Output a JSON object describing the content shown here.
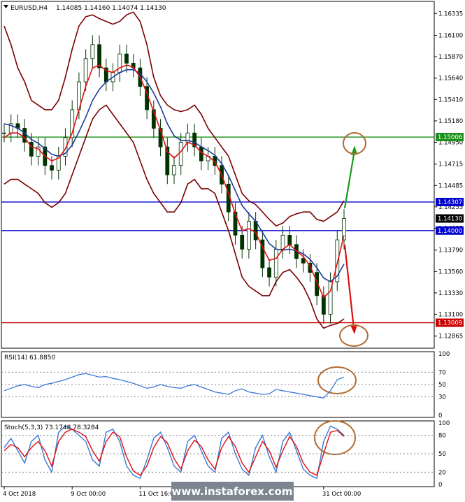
{
  "header": {
    "symbol": "EURUSD,H4",
    "ohlc": "1.14085 1.14160 1.14074 1.14130"
  },
  "watermark": "www.instaforex.com",
  "chart_data": [
    {
      "type": "candlestick",
      "name": "main",
      "ylim": [
        1.1275,
        1.1645
      ],
      "price_ticks": [
        "1.16335",
        "1.16100",
        "1.15870",
        "1.15640",
        "1.15410",
        "1.15180",
        "1.14950",
        "1.14715",
        "1.14485",
        "1.14255",
        "1.14025",
        "1.13790",
        "1.13560",
        "1.13330",
        "1.13100",
        "1.12865"
      ],
      "price_tick_values": [
        1.16335,
        1.161,
        1.1587,
        1.1564,
        1.1541,
        1.1518,
        1.1495,
        1.14715,
        1.14485,
        1.14255,
        1.14025,
        1.1379,
        1.1356,
        1.1333,
        1.131,
        1.12865
      ],
      "levels": [
        {
          "label": "1.15006",
          "value": 1.15006,
          "color": "#1a8f1a"
        },
        {
          "label": "1.14307",
          "value": 1.14307,
          "color": "#0000cc"
        },
        {
          "label": "1.14000",
          "value": 1.14,
          "color": "#0000cc"
        },
        {
          "label": "1.13009",
          "value": 1.13009,
          "color": "#cc0000"
        }
      ],
      "current_price": {
        "label": "1.14130",
        "value": 1.1413
      },
      "close": [
        1.1505,
        1.1515,
        1.151,
        1.1495,
        1.148,
        1.149,
        1.147,
        1.1465,
        1.148,
        1.15,
        1.153,
        1.156,
        1.1585,
        1.16,
        1.1575,
        1.156,
        1.157,
        1.159,
        1.158,
        1.1575,
        1.1555,
        1.153,
        1.151,
        1.149,
        1.146,
        1.147,
        1.1495,
        1.1505,
        1.149,
        1.1475,
        1.148,
        1.147,
        1.145,
        1.142,
        1.1395,
        1.138,
        1.141,
        1.139,
        1.136,
        1.135,
        1.138,
        1.1395,
        1.1385,
        1.137,
        1.1365,
        1.1355,
        1.133,
        1.131,
        1.1345,
        1.139,
        1.1413
      ],
      "ma_fast": [
        1.15,
        1.1505,
        1.1505,
        1.15,
        1.149,
        1.1488,
        1.148,
        1.1475,
        1.1478,
        1.1488,
        1.1505,
        1.153,
        1.1555,
        1.1575,
        1.1578,
        1.1572,
        1.157,
        1.1575,
        1.1578,
        1.1576,
        1.1565,
        1.1548,
        1.1528,
        1.1508,
        1.1485,
        1.1478,
        1.1485,
        1.1495,
        1.1492,
        1.1484,
        1.148,
        1.1474,
        1.146,
        1.144,
        1.1418,
        1.14,
        1.1402,
        1.1398,
        1.1382,
        1.1368,
        1.137,
        1.138,
        1.1385,
        1.1378,
        1.1372,
        1.1362,
        1.1345,
        1.1328,
        1.1335,
        1.1365,
        1.1395
      ],
      "ma_slow": [
        1.1515,
        1.1513,
        1.151,
        1.1505,
        1.1498,
        1.1494,
        1.1488,
        1.1482,
        1.148,
        1.1483,
        1.1492,
        1.1506,
        1.1522,
        1.154,
        1.1552,
        1.156,
        1.1565,
        1.157,
        1.1573,
        1.1573,
        1.1569,
        1.156,
        1.1548,
        1.1533,
        1.1515,
        1.1502,
        1.1497,
        1.1497,
        1.1495,
        1.149,
        1.1486,
        1.1481,
        1.1472,
        1.1459,
        1.1443,
        1.1427,
        1.1418,
        1.141,
        1.1398,
        1.1386,
        1.138,
        1.1379,
        1.138,
        1.1378,
        1.1375,
        1.1369,
        1.136,
        1.1349,
        1.1345,
        1.1351,
        1.1364
      ],
      "bb_upper": [
        1.162,
        1.16,
        1.1575,
        1.156,
        1.154,
        1.1535,
        1.153,
        1.153,
        1.154,
        1.1565,
        1.1595,
        1.162,
        1.163,
        1.1632,
        1.1628,
        1.1625,
        1.1622,
        1.1625,
        1.1632,
        1.1635,
        1.1625,
        1.16,
        1.1565,
        1.1545,
        1.1535,
        1.153,
        1.1528,
        1.153,
        1.1535,
        1.1525,
        1.151,
        1.15,
        1.149,
        1.148,
        1.146,
        1.144,
        1.1432,
        1.1428,
        1.142,
        1.1412,
        1.1405,
        1.1408,
        1.1415,
        1.1418,
        1.142,
        1.142,
        1.1412,
        1.141,
        1.1415,
        1.142,
        1.1432
      ],
      "bb_lower": [
        1.145,
        1.1455,
        1.1455,
        1.145,
        1.1445,
        1.144,
        1.143,
        1.1425,
        1.143,
        1.144,
        1.146,
        1.148,
        1.15,
        1.152,
        1.153,
        1.1535,
        1.1525,
        1.1515,
        1.1505,
        1.1495,
        1.1475,
        1.1455,
        1.144,
        1.143,
        1.142,
        1.142,
        1.143,
        1.145,
        1.1455,
        1.1445,
        1.1445,
        1.144,
        1.142,
        1.14,
        1.1375,
        1.135,
        1.134,
        1.1335,
        1.133,
        1.133,
        1.1345,
        1.1355,
        1.1358,
        1.135,
        1.134,
        1.1325,
        1.1305,
        1.1295,
        1.1298,
        1.13,
        1.1305
      ]
    },
    {
      "type": "line",
      "name": "rsi",
      "label": "RSI(14) 61.8850",
      "ylim": [
        0,
        100
      ],
      "ticks": [
        "100",
        "70",
        "50",
        "30",
        "0"
      ],
      "tick_values": [
        100,
        70,
        50,
        30,
        0
      ],
      "values": [
        40,
        44,
        48,
        50,
        47,
        45,
        50,
        52,
        55,
        58,
        62,
        66,
        68,
        65,
        62,
        63,
        60,
        58,
        55,
        52,
        48,
        44,
        46,
        50,
        47,
        45,
        44,
        48,
        50,
        46,
        42,
        38,
        36,
        34,
        40,
        43,
        38,
        36,
        34,
        35,
        42,
        40,
        38,
        36,
        34,
        32,
        30,
        28,
        40,
        58,
        62
      ]
    },
    {
      "type": "line",
      "name": "stochastic",
      "label": "Stoch(5,3,3) 73.1748 78.3284",
      "ylim": [
        0,
        100
      ],
      "ticks": [
        "100",
        "80",
        "50",
        "20",
        "0"
      ],
      "tick_values": [
        100,
        80,
        50,
        20,
        0
      ],
      "main": [
        60,
        75,
        55,
        35,
        70,
        80,
        40,
        20,
        85,
        95,
        90,
        80,
        70,
        40,
        30,
        85,
        90,
        70,
        30,
        15,
        10,
        40,
        75,
        85,
        60,
        30,
        20,
        70,
        80,
        55,
        30,
        20,
        75,
        85,
        50,
        25,
        15,
        60,
        80,
        45,
        20,
        70,
        85,
        55,
        25,
        15,
        10,
        70,
        95,
        90,
        80
      ],
      "signal": [
        55,
        65,
        60,
        45,
        60,
        70,
        55,
        30,
        70,
        85,
        90,
        85,
        78,
        55,
        38,
        70,
        85,
        78,
        45,
        22,
        15,
        30,
        60,
        78,
        68,
        42,
        25,
        55,
        72,
        62,
        40,
        25,
        60,
        78,
        62,
        35,
        20,
        45,
        70,
        55,
        28,
        55,
        78,
        62,
        35,
        20,
        15,
        50,
        85,
        88,
        78
      ]
    },
    {
      "type": "axis",
      "name": "time",
      "labels": [
        "4 Oct 2018",
        "9 Oct 00:00",
        "11 Oct 16:00",
        "16 Oct 08:00",
        "31 Oct 00:00"
      ],
      "label_index": [
        0,
        10,
        20,
        31,
        47
      ]
    }
  ]
}
